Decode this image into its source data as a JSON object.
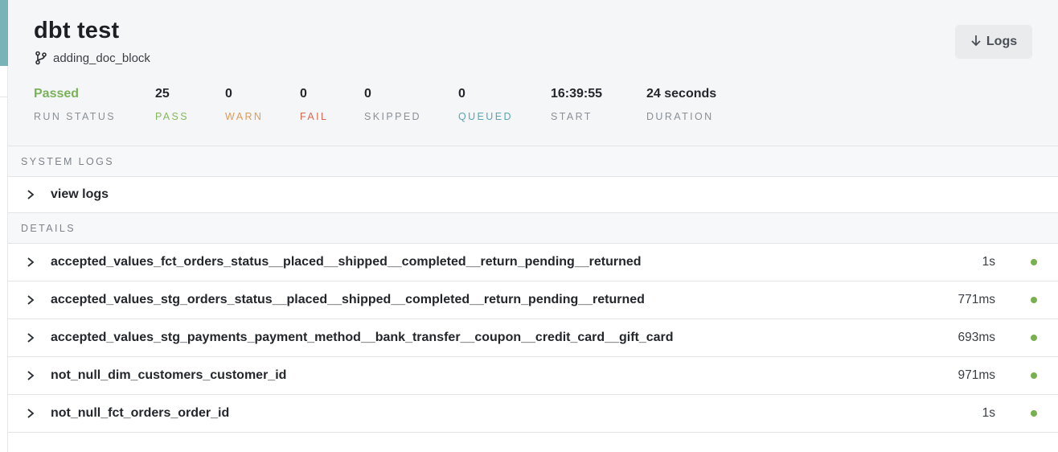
{
  "run": {
    "title": "dbt test",
    "branch": "adding_doc_block",
    "logs_button": "Logs"
  },
  "stats": [
    {
      "value": "Passed",
      "label": "RUN STATUS",
      "value_color": "#7ab25a",
      "label_color": "#8a9097"
    },
    {
      "value": "25",
      "label": "PASS",
      "value_color": "#23272c",
      "label_color": "#86b85c"
    },
    {
      "value": "0",
      "label": "WARN",
      "value_color": "#23272c",
      "label_color": "#e09a5a"
    },
    {
      "value": "0",
      "label": "FAIL",
      "value_color": "#23272c",
      "label_color": "#d9674f"
    },
    {
      "value": "0",
      "label": "SKIPPED",
      "value_color": "#23272c",
      "label_color": "#8a9097"
    },
    {
      "value": "0",
      "label": "QUEUED",
      "value_color": "#23272c",
      "label_color": "#5aa6b0"
    },
    {
      "value": "16:39:55",
      "label": "START",
      "value_color": "#23272c",
      "label_color": "#8a9097"
    },
    {
      "value": "24 seconds",
      "label": "DURATION",
      "value_color": "#23272c",
      "label_color": "#8a9097"
    }
  ],
  "system_logs": {
    "heading": "SYSTEM LOGS",
    "row_label": "view logs"
  },
  "details": {
    "heading": "DETAILS",
    "tests": [
      {
        "name": "accepted_values_fct_orders_status__placed__shipped__completed__return_pending__returned",
        "duration": "1s",
        "status_color": "#79b04f"
      },
      {
        "name": "accepted_values_stg_orders_status__placed__shipped__completed__return_pending__returned",
        "duration": "771ms",
        "status_color": "#79b04f"
      },
      {
        "name": "accepted_values_stg_payments_payment_method__bank_transfer__coupon__credit_card__gift_card",
        "duration": "693ms",
        "status_color": "#79b04f"
      },
      {
        "name": "not_null_dim_customers_customer_id",
        "duration": "971ms",
        "status_color": "#79b04f"
      },
      {
        "name": "not_null_fct_orders_order_id",
        "duration": "1s",
        "status_color": "#79b04f"
      }
    ]
  },
  "icons": {
    "branch": "git-branch-icon",
    "download": "arrow-down-icon",
    "expand": "chevron-right-icon",
    "status": "status-dot-icon"
  }
}
